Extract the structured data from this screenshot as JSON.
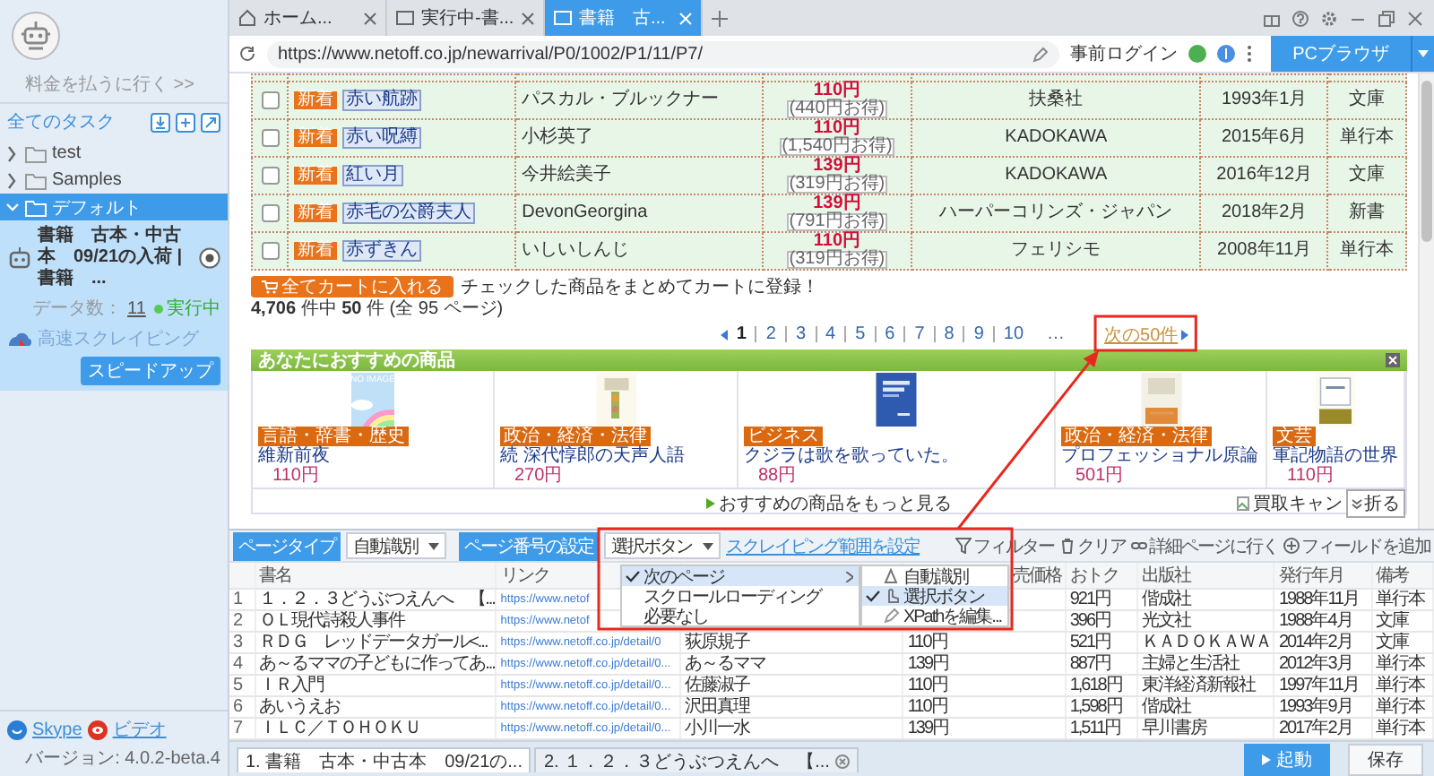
{
  "sidebar": {
    "pay_link": "料金を払うに行く >>",
    "all_tasks": "全てのタスク",
    "folders": [
      {
        "name": "test",
        "expanded": false,
        "selected": false
      },
      {
        "name": "Samples",
        "expanded": false,
        "selected": false
      },
      {
        "name": "デフォルト",
        "expanded": true,
        "selected": true
      }
    ],
    "task": {
      "title": "書籍　古本・中古本　09/21の入荷 | 書籍　...",
      "count_label": "データ数：",
      "count": "11",
      "status": "実行中",
      "mode": "高速スクレイピング",
      "speed_button": "スピードアップ"
    },
    "footer_links": [
      {
        "label": "Skype",
        "kind": "skype"
      },
      {
        "label": "ビデオ",
        "kind": "video"
      }
    ],
    "version": "バージョン: 4.0.2-beta.4"
  },
  "browser": {
    "tabs": [
      {
        "label": "ホーム...",
        "kind": "home",
        "selected": false
      },
      {
        "label": "実行中-書...",
        "kind": "page",
        "selected": false
      },
      {
        "label": "書籍　古...",
        "kind": "page",
        "selected": true
      }
    ],
    "url": "https://www.netoff.co.jp/newarrival/P0/1002/P1/11/P7/",
    "pre_login": "事前ログイン",
    "mode_button": "PCブラウザ"
  },
  "page": {
    "rows": [
      {
        "checked": false,
        "badge": "新着",
        "title": "赤い航跡",
        "author": "パスカル・ブルックナー",
        "price": "110円",
        "saving": "(440円お得)",
        "publisher": "扶桑社",
        "date": "1993年1月",
        "format": "文庫"
      },
      {
        "checked": false,
        "badge": "新着",
        "title": "赤い呪縛",
        "author": "小杉英了",
        "price": "110円",
        "saving": "(1,540円お得)",
        "publisher": "KADOKAWA",
        "date": "2015年6月",
        "format": "単行本"
      },
      {
        "checked": false,
        "badge": "新着",
        "title": "紅い月",
        "author": "今井絵美子",
        "price": "139円",
        "saving": "(319円お得)",
        "publisher": "KADOKAWA",
        "date": "2016年12月",
        "format": "文庫"
      },
      {
        "checked": false,
        "badge": "新着",
        "title": "赤毛の公爵夫人",
        "author": "DevonGeorgina",
        "price": "139円",
        "saving": "(791円お得)",
        "publisher": "ハーパーコリンズ・ジャパン",
        "date": "2018年2月",
        "format": "新書"
      },
      {
        "checked": false,
        "badge": "新着",
        "title": "赤ずきん",
        "author": "いしいしんじ",
        "price": "110円",
        "saving": "(319円お得)",
        "publisher": "フェリシモ",
        "date": "2008年11月",
        "format": "単行本"
      }
    ],
    "cart_button": "全てカートに入れる",
    "cart_note": "チェックした商品をまとめてカートに登録！",
    "count": "**4,706** 件中 **50** 件 (全 95 ページ)",
    "pages": [
      {
        "label": "1",
        "selected": true
      },
      {
        "label": "2",
        "selected": false
      },
      {
        "label": "3",
        "selected": false
      },
      {
        "label": "4",
        "selected": false
      },
      {
        "label": "5",
        "selected": false
      },
      {
        "label": "6",
        "selected": false
      },
      {
        "label": "7",
        "selected": false
      },
      {
        "label": "8",
        "selected": false
      },
      {
        "label": "9",
        "selected": false
      },
      {
        "label": "10",
        "selected": false
      }
    ],
    "ellipsis": "…",
    "next": "次の50件",
    "recommend_title": "あなたにおすすめの商品",
    "products": [
      {
        "cover": "NO IMAGE",
        "genre": "言語・辞書・歴史",
        "title": "維新前夜",
        "price": "110円"
      },
      {
        "genre": "政治・経済・法律",
        "title": "続 深代惇郎の天声人語",
        "price": "270円"
      },
      {
        "genre": "ビジネス",
        "title": "クジラは歌を歌っていた。",
        "price": "88円"
      },
      {
        "genre": "政治・経済・法律",
        "title": "プロフェッショナル原論",
        "price": "501円"
      },
      {
        "genre": "文芸",
        "title": "軍記物語の世界",
        "price": "110円"
      }
    ],
    "more_link": "おすすめの商品をもっと見る",
    "broken_image": "買取キャン",
    "collapse": "折る"
  },
  "panel": {
    "page_type_label": "ページタイプ",
    "page_type": "自動識別",
    "paging_label": "ページ番号の設定",
    "paging": "選択ボタン",
    "range_link": "スクレイピング範囲を設定",
    "tools": [
      {
        "label": "フィルター",
        "kind": "filter"
      },
      {
        "label": "クリア",
        "kind": "clear"
      },
      {
        "label": "詳細ページに行く",
        "kind": "link"
      },
      {
        "label": "フィールドを追加",
        "kind": "add"
      }
    ],
    "menu": [
      {
        "label": "次のページ",
        "checked": true,
        "selected": true,
        "submenu": true
      },
      {
        "label": "スクロールローディング",
        "checked": false,
        "selected": false,
        "submenu": false
      },
      {
        "label": "必要なし",
        "checked": false,
        "selected": false,
        "submenu": false
      }
    ],
    "submenu": [
      {
        "label": "自動識別",
        "kind": "auto",
        "checked": false,
        "selected": false
      },
      {
        "label": "選択ボタン",
        "kind": "click",
        "checked": true,
        "selected": true
      },
      {
        "label": "XPathを編集...",
        "kind": "edit",
        "checked": false,
        "selected": false
      }
    ],
    "columns": [
      "書名",
      "リンク",
      null,
      "売価格",
      "おトク",
      "出版社",
      "発行年月",
      "備考"
    ],
    "rows": [
      {
        "index": "1",
        "cells": [
          "１．２．３どうぶつえんへ　【...",
          "https://www.netof",
          null,
          null,
          "921円",
          "偕成社",
          "1988年11月",
          "単行本"
        ]
      },
      {
        "index": "2",
        "cells": [
          "ＯＬ現代詩殺人事件",
          "https://www.netof",
          null,
          null,
          "396円",
          "光文社",
          "1988年4月",
          "文庫"
        ]
      },
      {
        "index": "3",
        "cells": [
          "ＲＤＧ　レッドデータガール<...",
          "https://www.netoff.co.jp/detail/0",
          "荻原規子",
          "110円",
          "521円",
          "ＫＡＤＯＫＡＷＡ",
          "2014年2月",
          "文庫"
        ]
      },
      {
        "index": "4",
        "cells": [
          "あ～るママの子どもに作ってあ...",
          "https://www.netoff.co.jp/detail/0...",
          "あ～るママ",
          "139円",
          "887円",
          "主婦と生活社",
          "2012年3月",
          "単行本"
        ]
      },
      {
        "index": "5",
        "cells": [
          "ＩＲ入門",
          "https://www.netoff.co.jp/detail/0...",
          "佐藤淑子",
          "110円",
          "1,618円",
          "東洋経済新報社",
          "1997年11月",
          "単行本"
        ]
      },
      {
        "index": "6",
        "cells": [
          "あいうえお",
          "https://www.netoff.co.jp/detail/0...",
          "沢田真理",
          "110円",
          "1,598円",
          "偕成社",
          "1993年9月",
          "単行本"
        ]
      },
      {
        "index": "7",
        "cells": [
          "ＩＬＣ／ＴＯＨＯＫＵ",
          "https://www.netoff.co.jp/detail/0...",
          "小川一水",
          "139円",
          "1,511円",
          "早川書房",
          "2017年2月",
          "単行本"
        ]
      }
    ],
    "task_tabs": [
      {
        "label": "1. 書籍　古本・中古本　09/21の...",
        "selected": true,
        "closable": false
      },
      {
        "label": "2. １．２．３どうぶつえんへ　【...",
        "selected": false,
        "closable": true
      }
    ],
    "start_button": "起動",
    "save_button": "保存"
  }
}
